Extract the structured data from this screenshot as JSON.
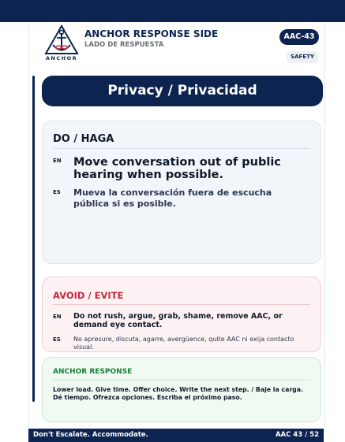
{
  "header": {
    "logo_word": "ANCHOR",
    "title": "ANCHOR RESPONSE SIDE",
    "subtitle": "LADO DE RESPUESTA",
    "code_badge": "AAC-43",
    "category_badge": "SAFETY"
  },
  "card_title": "Privacy / Privacidad",
  "do_section": {
    "heading": "DO / HAGA",
    "en_tag": "EN",
    "en_text": "Move conversation out of public hearing when possible.",
    "es_tag": "ES",
    "es_text": "Mueva la conversación fuera de escucha pública si es posible."
  },
  "avoid_section": {
    "heading": "AVOID / EVITE",
    "en_tag": "EN",
    "en_text": "Do not rush, argue, grab, shame, remove AAC, or demand eye contact.",
    "es_tag": "ES",
    "es_text": "No apresure, discuta, agarre, avergüence, quite AAC ni exija contacto visual."
  },
  "response_section": {
    "heading": "ANCHOR RESPONSE",
    "text": "Lower load. Give time. Offer choice. Write the next step. / Baje la carga. Dé tiempo. Ofrezca opciones. Escriba el próximo paso."
  },
  "footer": {
    "tagline": "Don't Escalate. Accommodate.",
    "page": "AAC 43 / 52"
  },
  "colors": {
    "navy": "#0d2450",
    "avoid_red": "#c8283d",
    "response_green": "#1a7f3a"
  },
  "icons": {
    "logo": "anchor-triangle-logo"
  }
}
